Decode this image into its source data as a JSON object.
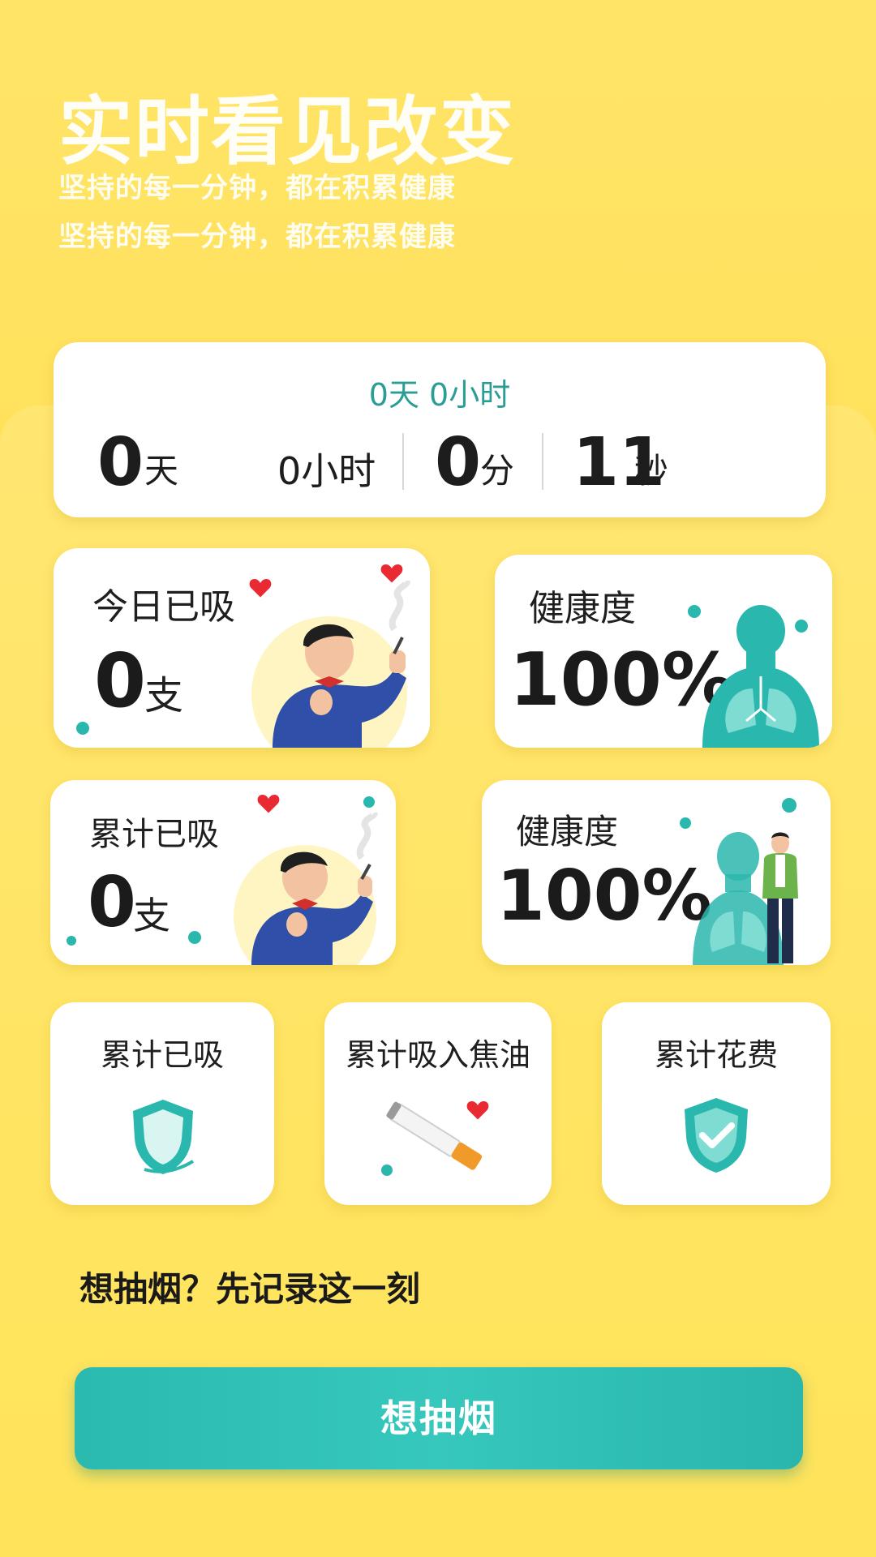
{
  "hero": {
    "title": "实时看见改变",
    "subtitle_1": "坚持的每一分钟，都在积累健康",
    "subtitle_2": "坚持的每一分钟，都在积累健康"
  },
  "timer": {
    "summary": "0天 0小时",
    "days_value": "0",
    "days_unit": "天",
    "hours_text": "0小时",
    "minutes_value": "0",
    "minutes_unit": "分",
    "seconds_value": "11",
    "seconds_unit": "秒"
  },
  "today_card": {
    "label": "今日已吸",
    "value": "0",
    "unit": "支"
  },
  "health_card_1": {
    "label": "健康度",
    "value": "100%"
  },
  "total_card": {
    "label": "累计已吸",
    "value": "0",
    "unit": "支"
  },
  "health_card_2": {
    "label": "健康度",
    "value": "100%"
  },
  "small_cards": [
    {
      "label": "累计已吸",
      "icon": "shield-icon"
    },
    {
      "label": "累计吸入焦油",
      "icon": "cigarette-icon"
    },
    {
      "label": "累计花费",
      "icon": "shield-check-icon"
    }
  ],
  "prompt": {
    "text": "想抽烟？先记录这一刻"
  },
  "action": {
    "button_label": "想抽烟"
  },
  "colors": {
    "accent": "#2ab7ad",
    "background": "#ffe35a",
    "heart": "#ea2a33"
  }
}
